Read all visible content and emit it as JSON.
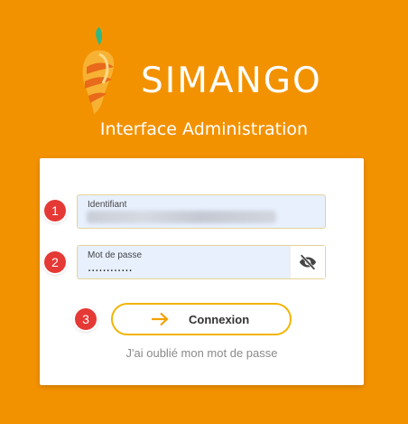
{
  "header": {
    "brand": "SIMANGO",
    "subtitle": "Interface Administration"
  },
  "form": {
    "identifier_label": "Identifiant",
    "password_label": "Mot de passe",
    "password_value": "............",
    "submit_label": "Connexion",
    "forgot_link": "J'ai oublié mon mot de passe"
  },
  "annotations": [
    "1",
    "2",
    "3"
  ],
  "icons": {
    "logo": "mango-logo-icon",
    "toggle_password": "eye-off-icon",
    "submit": "arrow-right-icon"
  },
  "colors": {
    "background": "#F39200",
    "accent": "#F2B400",
    "badge": "#E53935",
    "input_bg": "#E8F0FE"
  }
}
